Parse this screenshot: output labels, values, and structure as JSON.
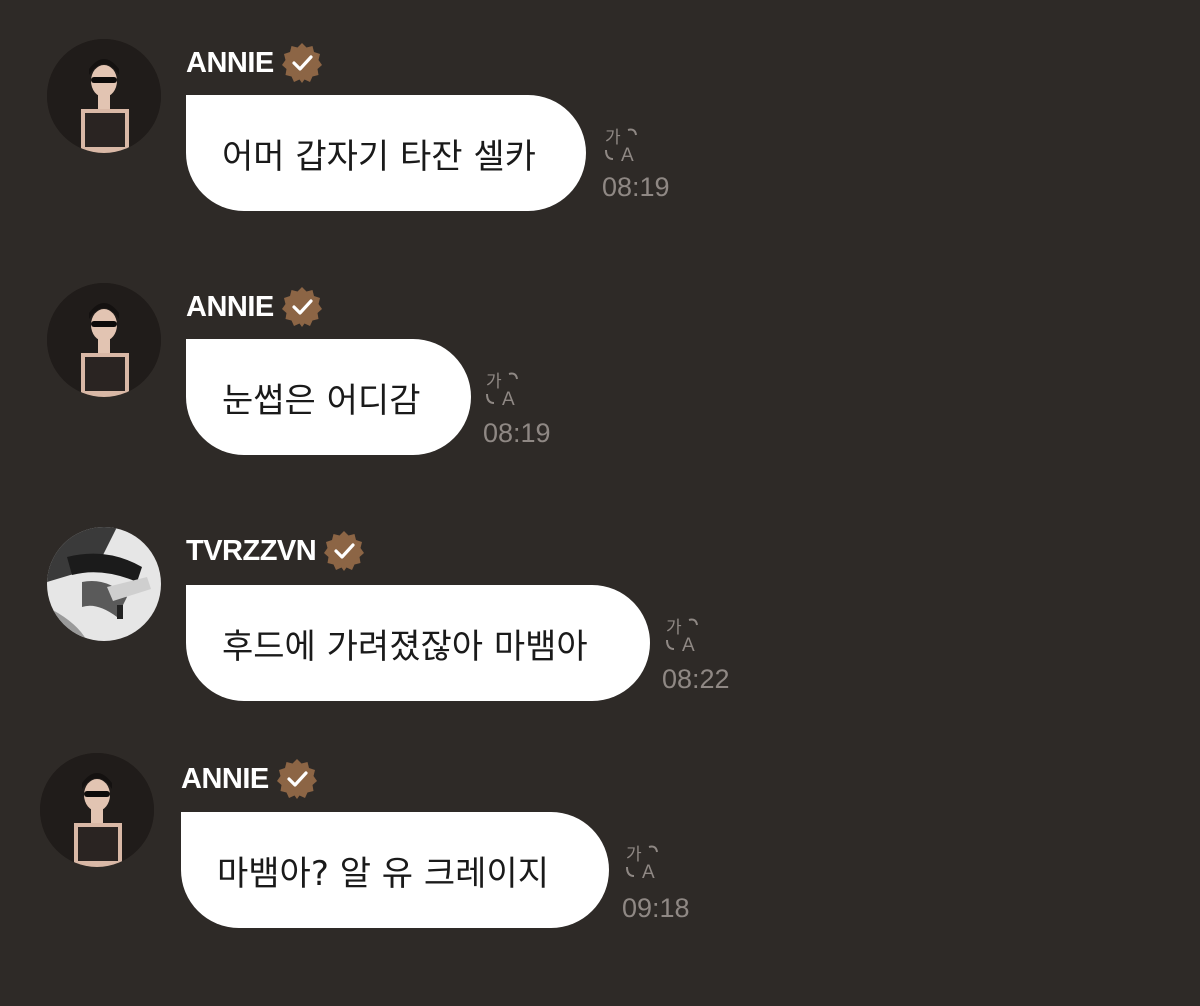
{
  "colors": {
    "background": "#2e2a27",
    "bubble": "#ffffff",
    "verified_badge": "#8c6545",
    "timestamp": "#8f8884"
  },
  "messages": [
    {
      "username": "ANNIE",
      "verified": true,
      "avatar": "annie-avatar",
      "text": "어머 갑자기 타잔 셀카",
      "time": "08:19",
      "translate_icon": "translate-icon"
    },
    {
      "username": "ANNIE",
      "verified": true,
      "avatar": "annie-avatar",
      "text": "눈썹은 어디감",
      "time": "08:19",
      "translate_icon": "translate-icon"
    },
    {
      "username": "TVRZZVN",
      "verified": true,
      "avatar": "tvrzzvn-avatar",
      "text": "후드에 가려졌잖아 마뱀아",
      "time": "08:22",
      "translate_icon": "translate-icon"
    },
    {
      "username": "ANNIE",
      "verified": true,
      "avatar": "annie-avatar",
      "text": "마뱀아? 알 유 크레이지",
      "time": "09:18",
      "translate_icon": "translate-icon"
    }
  ]
}
